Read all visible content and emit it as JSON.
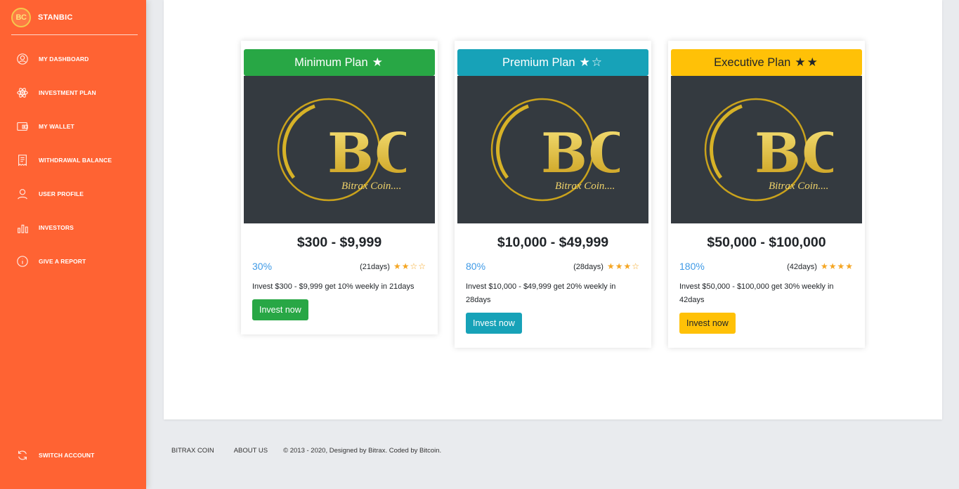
{
  "brand": {
    "logo_text": "BC",
    "name": "STANBIC"
  },
  "nav": [
    {
      "label": "MY DASHBOARD",
      "icon": "dashboard-icon"
    },
    {
      "label": "INVESTMENT PLAN",
      "icon": "atom-icon"
    },
    {
      "label": "MY WALLET",
      "icon": "wallet-icon"
    },
    {
      "label": "WITHDRAWAL BALANCE",
      "icon": "receipt-icon"
    },
    {
      "label": "USER PROFILE",
      "icon": "user-icon"
    },
    {
      "label": "INVESTORS",
      "icon": "bar-chart-icon"
    },
    {
      "label": "GIVE A REPORT",
      "icon": "info-icon"
    }
  ],
  "switch_account": {
    "label": "SWITCH ACCOUNT",
    "icon": "refresh-icon"
  },
  "logo_image": {
    "monogram": "BC",
    "caption": "Bitrax Coin...."
  },
  "plans": [
    {
      "title": "Minimum Plan",
      "header_stars": "★",
      "price": "$300 - $9,999",
      "rate": "30%",
      "days": "(21days)",
      "rating": "★★☆☆",
      "description": "Invest $300 - $9,999 get 10% weekly in 21days",
      "button": "Invest now",
      "color": "#28a745"
    },
    {
      "title": "Premium Plan",
      "header_stars": "★☆",
      "price": "$10,000 - $49,999",
      "rate": "80%",
      "days": "(28days)",
      "rating": "★★★☆",
      "description": "Invest $10,000 - $49,999 get 20% weekly in 28days",
      "button": "Invest now",
      "color": "#17a2b8"
    },
    {
      "title": "Executive Plan",
      "header_stars": "★★",
      "price": "$50,000 - $100,000",
      "rate": "180%",
      "days": "(42days)",
      "rating": "★★★★",
      "description": "Invest $50,000 - $100,000 get 30% weekly in 42days",
      "button": "Invest now",
      "color": "#ffc107"
    }
  ],
  "footer": {
    "link1": "BITRAX COIN",
    "link2": "ABOUT US",
    "copyright": "© 2013 - 2020, Designed by Bitrax. Coded by Bitcoin."
  }
}
